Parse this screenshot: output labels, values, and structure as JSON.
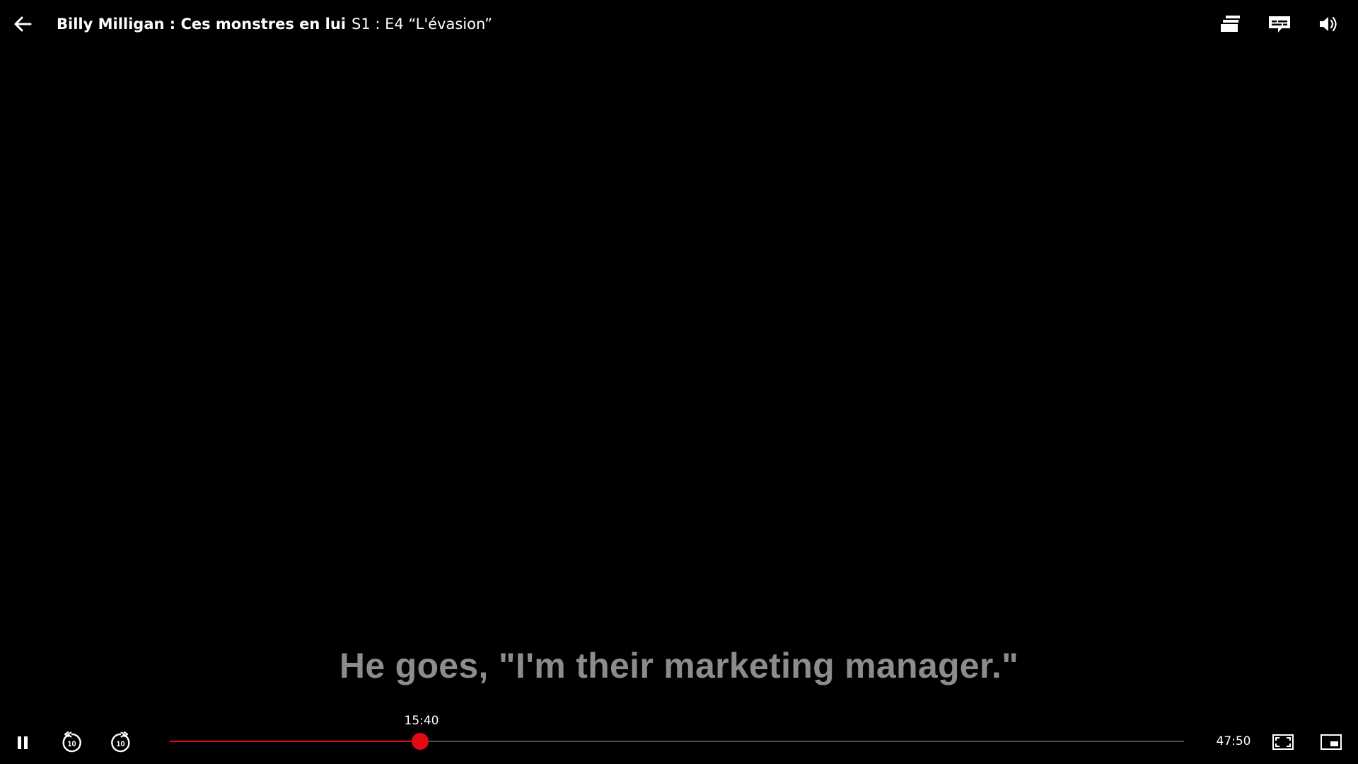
{
  "header": {
    "back_label": "Back",
    "show_title": "Billy Milligan : Ces monstres en lui",
    "episode_info": "S1 : E4 “L'évasion”"
  },
  "top_right_icons": [
    "episodes-icon",
    "subtitles-icon",
    "volume-icon"
  ],
  "subtitle": {
    "text": "He goes, \"I'm their marketing manager.\""
  },
  "playback": {
    "current_time": "15:40",
    "remaining_time": "47:50",
    "progress_fraction": 0.247,
    "state": "playing"
  },
  "colors": {
    "accent": "#e50914",
    "subtitle": "#8c8c8c",
    "track": "#4a4a4a",
    "background": "#000000"
  },
  "controls": {
    "rewind_seconds": "10",
    "forward_seconds": "10"
  }
}
